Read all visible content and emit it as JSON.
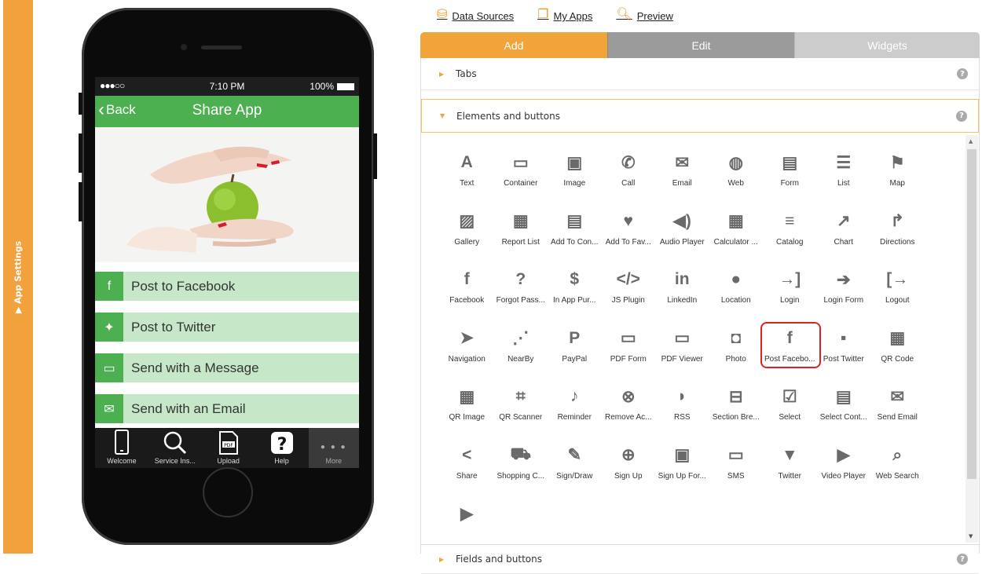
{
  "sidebar": {
    "label": "▶ App Settings"
  },
  "toplinks": [
    {
      "label": "Data Sources",
      "icon": "database-icon"
    },
    {
      "label": "My Apps",
      "icon": "copy-icon"
    },
    {
      "label": "Preview",
      "icon": "magnifier-icon"
    }
  ],
  "phone": {
    "status": {
      "signal": "●●●○○",
      "time": "7:10 PM",
      "battery": "100%"
    },
    "nav": {
      "back": "Back",
      "title": "Share App"
    },
    "share_items": [
      {
        "label": "Post to Facebook",
        "icon": "facebook-icon"
      },
      {
        "label": "Post to Twitter",
        "icon": "twitter-icon"
      },
      {
        "label": "Send with a Message",
        "icon": "message-icon"
      },
      {
        "label": "Send with an Email",
        "icon": "email-icon"
      }
    ],
    "tabbar": [
      {
        "label": "Welcome",
        "icon": "phone-icon"
      },
      {
        "label": "Service Ins...",
        "icon": "search-icon"
      },
      {
        "label": "Upload",
        "icon": "pdf-icon"
      },
      {
        "label": "Help",
        "icon": "help-icon"
      },
      {
        "label": "More",
        "icon": "more-icon"
      }
    ]
  },
  "panel": {
    "tabs": {
      "add": "Add",
      "edit": "Edit",
      "widgets": "Widgets"
    },
    "sections": {
      "tabs": "Tabs",
      "elements": "Elements and buttons",
      "fields": "Fields and buttons"
    },
    "help": "?",
    "elements": [
      {
        "label": "Text",
        "glyph": "A"
      },
      {
        "label": "Container",
        "glyph": "▭"
      },
      {
        "label": "Image",
        "glyph": "▣"
      },
      {
        "label": "Call",
        "glyph": "✆"
      },
      {
        "label": "Email",
        "glyph": "✉"
      },
      {
        "label": "Web",
        "glyph": "◍"
      },
      {
        "label": "Form",
        "glyph": "▤"
      },
      {
        "label": "List",
        "glyph": "☰"
      },
      {
        "label": "Map",
        "glyph": "⚑"
      },
      {
        "label": "Gallery",
        "glyph": "▨"
      },
      {
        "label": "Report List",
        "glyph": "▦"
      },
      {
        "label": "Add To Con...",
        "glyph": "▤"
      },
      {
        "label": "Add To Fav...",
        "glyph": "♥"
      },
      {
        "label": "Audio Player",
        "glyph": "◀)"
      },
      {
        "label": "Calculator ...",
        "glyph": "▦"
      },
      {
        "label": "Catalog",
        "glyph": "≡"
      },
      {
        "label": "Chart",
        "glyph": "↗"
      },
      {
        "label": "Directions",
        "glyph": "↱"
      },
      {
        "label": "Facebook",
        "glyph": "f"
      },
      {
        "label": "Forgot Pass...",
        "glyph": "?"
      },
      {
        "label": "In App Pur...",
        "glyph": "$"
      },
      {
        "label": "JS Plugin",
        "glyph": "</>"
      },
      {
        "label": "LinkedIn",
        "glyph": "in"
      },
      {
        "label": "Location",
        "glyph": "●"
      },
      {
        "label": "Login",
        "glyph": "→]"
      },
      {
        "label": "Login Form",
        "glyph": "➔"
      },
      {
        "label": "Logout",
        "glyph": "[→"
      },
      {
        "label": "Navigation",
        "glyph": "➤"
      },
      {
        "label": "NearBy",
        "glyph": "⋰"
      },
      {
        "label": "PayPal",
        "glyph": "P"
      },
      {
        "label": "PDF Form",
        "glyph": "▭"
      },
      {
        "label": "PDF Viewer",
        "glyph": "▭"
      },
      {
        "label": "Photo",
        "glyph": "◘"
      },
      {
        "label": "Post Facebo...",
        "glyph": "f"
      },
      {
        "label": "Post Twitter",
        "glyph": "▪"
      },
      {
        "label": "QR Code",
        "glyph": "▦"
      },
      {
        "label": "QR Image",
        "glyph": "▦"
      },
      {
        "label": "QR Scanner",
        "glyph": "⌗"
      },
      {
        "label": "Reminder",
        "glyph": "♪"
      },
      {
        "label": "Remove Ac...",
        "glyph": "⊗"
      },
      {
        "label": "RSS",
        "glyph": "◗"
      },
      {
        "label": "Section Bre...",
        "glyph": "⊟"
      },
      {
        "label": "Select",
        "glyph": "☑"
      },
      {
        "label": "Select Cont...",
        "glyph": "▤"
      },
      {
        "label": "Send Email",
        "glyph": "✉"
      },
      {
        "label": "Share",
        "glyph": "<"
      },
      {
        "label": "Shopping C...",
        "glyph": "⛟"
      },
      {
        "label": "Sign/Draw",
        "glyph": "✎"
      },
      {
        "label": "Sign Up",
        "glyph": "⊕"
      },
      {
        "label": "Sign Up For...",
        "glyph": "▣"
      },
      {
        "label": "SMS",
        "glyph": "▭"
      },
      {
        "label": "Twitter",
        "glyph": "▼"
      },
      {
        "label": "Video Player",
        "glyph": "▶"
      },
      {
        "label": "Web Search",
        "glyph": "⌕"
      },
      {
        "label": "",
        "glyph": "▶"
      }
    ]
  }
}
